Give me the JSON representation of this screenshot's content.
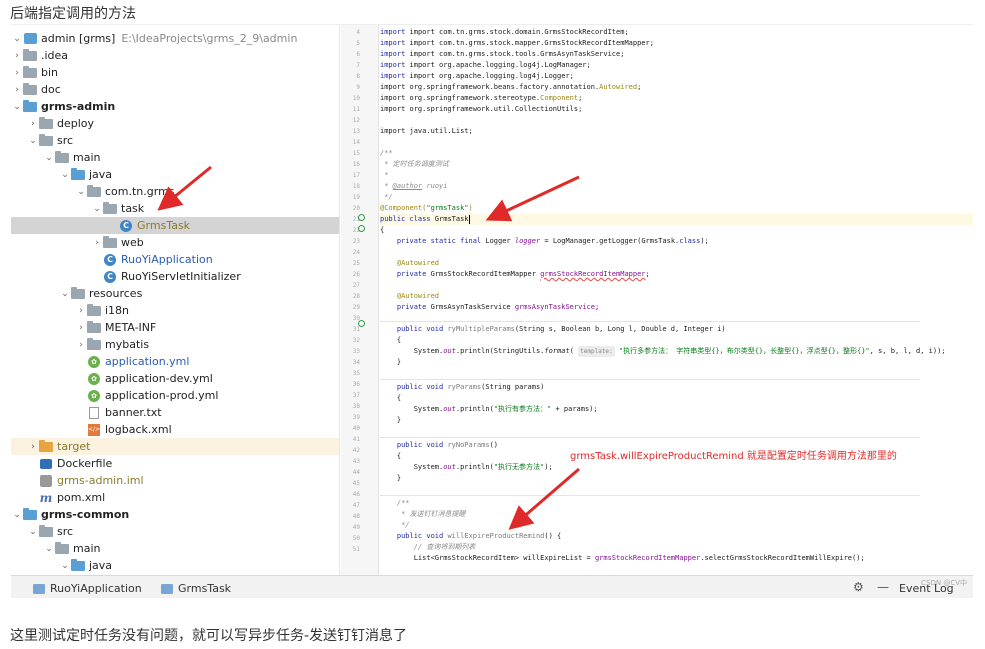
{
  "page": {
    "top_title": "后端指定调用的方法",
    "bottom_text": "这里测试定时任务没有问题，就可以写异步任务-发送钉钉消息了"
  },
  "tree": {
    "items": [
      {
        "label": "admin [grms]",
        "path": "E:\\IdeaProjects\\grms_2_9\\admin"
      },
      {
        "label": ".idea"
      },
      {
        "label": "bin"
      },
      {
        "label": "doc"
      },
      {
        "label": "grms-admin"
      },
      {
        "label": "deploy"
      },
      {
        "label": "src"
      },
      {
        "label": "main"
      },
      {
        "label": "java"
      },
      {
        "label": "com.tn.grms"
      },
      {
        "label": "task"
      },
      {
        "label": "GrmsTask"
      },
      {
        "label": "web"
      },
      {
        "label": "RuoYiApplication"
      },
      {
        "label": "RuoYiServletInitializer"
      },
      {
        "label": "resources"
      },
      {
        "label": "i18n"
      },
      {
        "label": "META-INF"
      },
      {
        "label": "mybatis"
      },
      {
        "label": "application.yml"
      },
      {
        "label": "application-dev.yml"
      },
      {
        "label": "application-prod.yml"
      },
      {
        "label": "banner.txt"
      },
      {
        "label": "logback.xml"
      },
      {
        "label": "target"
      },
      {
        "label": "Dockerfile"
      },
      {
        "label": "grms-admin.iml"
      },
      {
        "label": "pom.xml"
      },
      {
        "label": "grms-common"
      },
      {
        "label": "src"
      },
      {
        "label": "main"
      },
      {
        "label": "java"
      }
    ]
  },
  "gutter": {
    "line_numbers": [
      "4",
      "5",
      "6",
      "7",
      "8",
      "9",
      "10",
      "11",
      "12",
      "13",
      "14",
      "15",
      "16",
      "17",
      "18",
      "19",
      "20",
      "21",
      "22",
      "23",
      "24",
      "25",
      "26",
      "27",
      "28",
      "29",
      "30",
      "31",
      "32",
      "33",
      "34",
      "35",
      "36",
      "37",
      "38",
      "39",
      "40",
      "41",
      "42",
      "43",
      "44",
      "45",
      "46",
      "47",
      "48",
      "49",
      "50",
      "51"
    ]
  },
  "code": {
    "l4": "import com.tn.grms.stock.domain.GrmsStockRecordItem;",
    "l5": "import com.tn.grms.stock.mapper.GrmsStockRecordItemMapper;",
    "l6": "import com.tn.grms.stock.tools.GrmsAsynTaskService;",
    "l7": "import org.apache.logging.log4j.LogManager;",
    "l8": "import org.apache.logging.log4j.Logger;",
    "l9_a": "import org.springframework.beans.factory.annotation.",
    "l9_b": "Autowired",
    "l9_c": ";",
    "l10_a": "import org.springframework.stereotype.",
    "l10_b": "Component",
    "l10_c": ";",
    "l11": "import org.springframework.util.CollectionUtils;",
    "l13": "import java.util.List;",
    "l15": "/**",
    "l16": " * 定时任务调度测试",
    "l17": " *",
    "l18_a": " * ",
    "l18_b": "@author",
    "l18_c": " ruoyi",
    "l19": " */",
    "l20_a": "@Component(",
    "l20_b": "\"grmsTask\"",
    "l20_c": ")",
    "l21_a": "public class ",
    "l21_b": "GrmsTask",
    "l22": "{",
    "l23_a": "    private static final ",
    "l23_b": "Logger ",
    "l23_c": "logger",
    "l23_d": " = LogManager.getLogger(GrmsTask.",
    "l23_e": "class",
    "l23_f": ");",
    "l25": "    @Autowired",
    "l26_a": "    private ",
    "l26_b": "GrmsStockRecordItemMapper ",
    "l26_c": "grmsStockRecordItemMapper",
    "l26_d": ";",
    "l28": "    @Autowired",
    "l29_a": "    private ",
    "l29_b": "GrmsAsynTaskService ",
    "l29_c": "grmsAsynTaskService",
    "l29_d": ";",
    "l31_a": "    public void ",
    "l31_b": "ryMultipleParams",
    "l31_c": "(String s, Boolean b, Long l, Double d, Integer i)",
    "l32": "    {",
    "l33_a": "        System.",
    "l33_b": "out",
    "l33_c": ".println(StringUtils.",
    "l33_d": "format",
    "l33_e": "( ",
    "l33_hint": "template:",
    "l33_f": " ",
    "l33_g": "\"执行多参方法： 字符串类型{}，布尔类型{}，长整型{}，浮点型{}，整形{}\"",
    "l33_h": ", s, b, l, d, i));",
    "l34": "    }",
    "l36_a": "    public void ",
    "l36_b": "ryParams",
    "l36_c": "(String params)",
    "l37": "    {",
    "l38_a": "        System.",
    "l38_b": "out",
    "l38_c": ".println(",
    "l38_d": "\"执行有参方法：\"",
    "l38_e": " + params);",
    "l39": "    }",
    "l41_a": "    public void ",
    "l41_b": "ryNoParams",
    "l41_c": "()",
    "l42": "    {",
    "l43_a": "        System.",
    "l43_b": "out",
    "l43_c": ".println(",
    "l43_d": "\"执行无参方法\"",
    "l43_e": ");",
    "l44": "    }",
    "l46": "    /**",
    "l47": "     * 发送钉钉消息提醒",
    "l48": "     */",
    "l49_a": "    public void ",
    "l49_b": "willExpireProductRemind",
    "l49_c": "() {",
    "l50": "        // 查询将到期列表",
    "l51_a": "        List<GrmsStockRecordItem> willExpireList = ",
    "l51_b": "grmsStockRecordItemMapper",
    "l51_c": ".selectGrmsStockRecordItemWillExpire();"
  },
  "annotation": {
    "text": "grmsTask.willExpireProductRemind  就是配置定时任务调用方法那里的",
    "color": "#e02a2a"
  },
  "toolbar": {
    "tab1": "RuoYiApplication",
    "tab2": "GrmsTask",
    "event_log": "Event Log",
    "watermark": "CSDN @CV中"
  }
}
